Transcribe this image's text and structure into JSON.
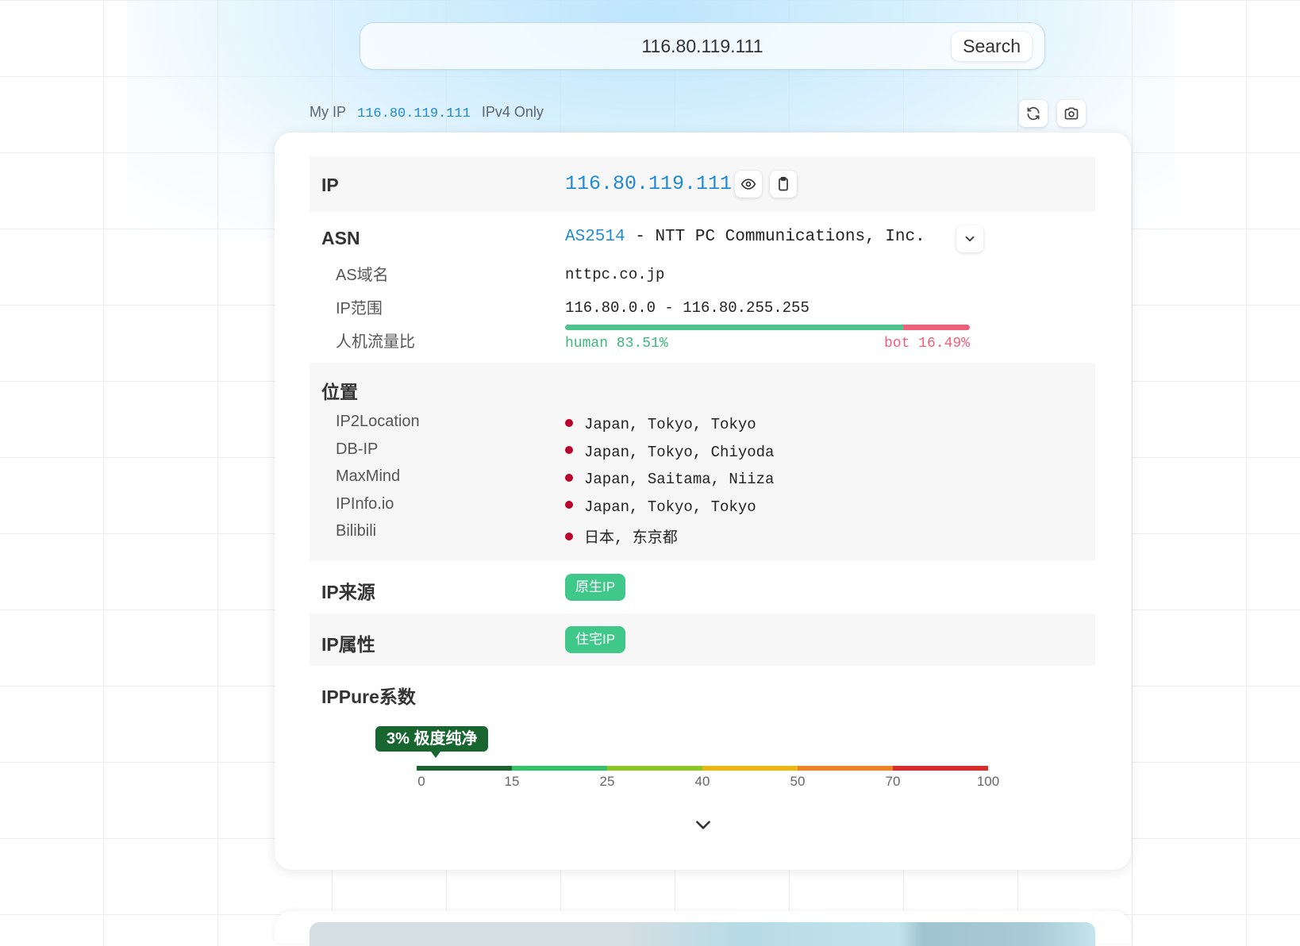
{
  "search": {
    "value": "116.80.119.111",
    "button_label": "Search"
  },
  "myip": {
    "label": "My IP",
    "value": "116.80.119.111",
    "mode": "IPv4 Only"
  },
  "toolbar": {
    "refresh_icon": "refresh-icon",
    "camera_icon": "camera-icon"
  },
  "ip_row": {
    "label": "IP",
    "value": "116.80.119.111",
    "eye_icon": "eye-icon",
    "copy_icon": "clipboard-icon"
  },
  "asn": {
    "label": "ASN",
    "number": "AS2514",
    "separator": " - ",
    "org": "NTT PC Communications, Inc.",
    "domain_label": "AS域名",
    "domain_value": "nttpc.co.jp",
    "range_label": "IP范围",
    "range_value": "116.80.0.0 - 116.80.255.255",
    "ratio_label": "人机流量比",
    "human_text": "human 83.51%",
    "bot_text": "bot 16.49%",
    "human_percent": 83.51,
    "bot_percent": 16.49,
    "human_color": "#4cc38a",
    "bot_color": "#ef5f7a"
  },
  "location": {
    "label": "位置",
    "sources": [
      {
        "name": "IP2Location",
        "value": "Japan, Tokyo, Tokyo"
      },
      {
        "name": "DB-IP",
        "value": "Japan, Tokyo, Chiyoda"
      },
      {
        "name": "MaxMind",
        "value": "Japan, Saitama, Niiza"
      },
      {
        "name": "IPInfo.io",
        "value": "Japan, Tokyo, Tokyo"
      },
      {
        "name": "Bilibili",
        "value": "日本, 东京都"
      }
    ],
    "flag_color": "#bc002d"
  },
  "source": {
    "label": "IP来源",
    "badge": "原生IP"
  },
  "attribute": {
    "label": "IP属性",
    "badge": "住宅IP"
  },
  "pure": {
    "label": "IPPure系数",
    "score": 3,
    "score_text": "3% 极度纯净",
    "ticks": [
      "0",
      "15",
      "25",
      "40",
      "50",
      "70",
      "100"
    ],
    "segment_colors": [
      "#17652f",
      "#2fc468",
      "#8cc91f",
      "#efb70c",
      "#f58020",
      "#e02a2a"
    ]
  },
  "expand_icon": "chevron-down-icon"
}
